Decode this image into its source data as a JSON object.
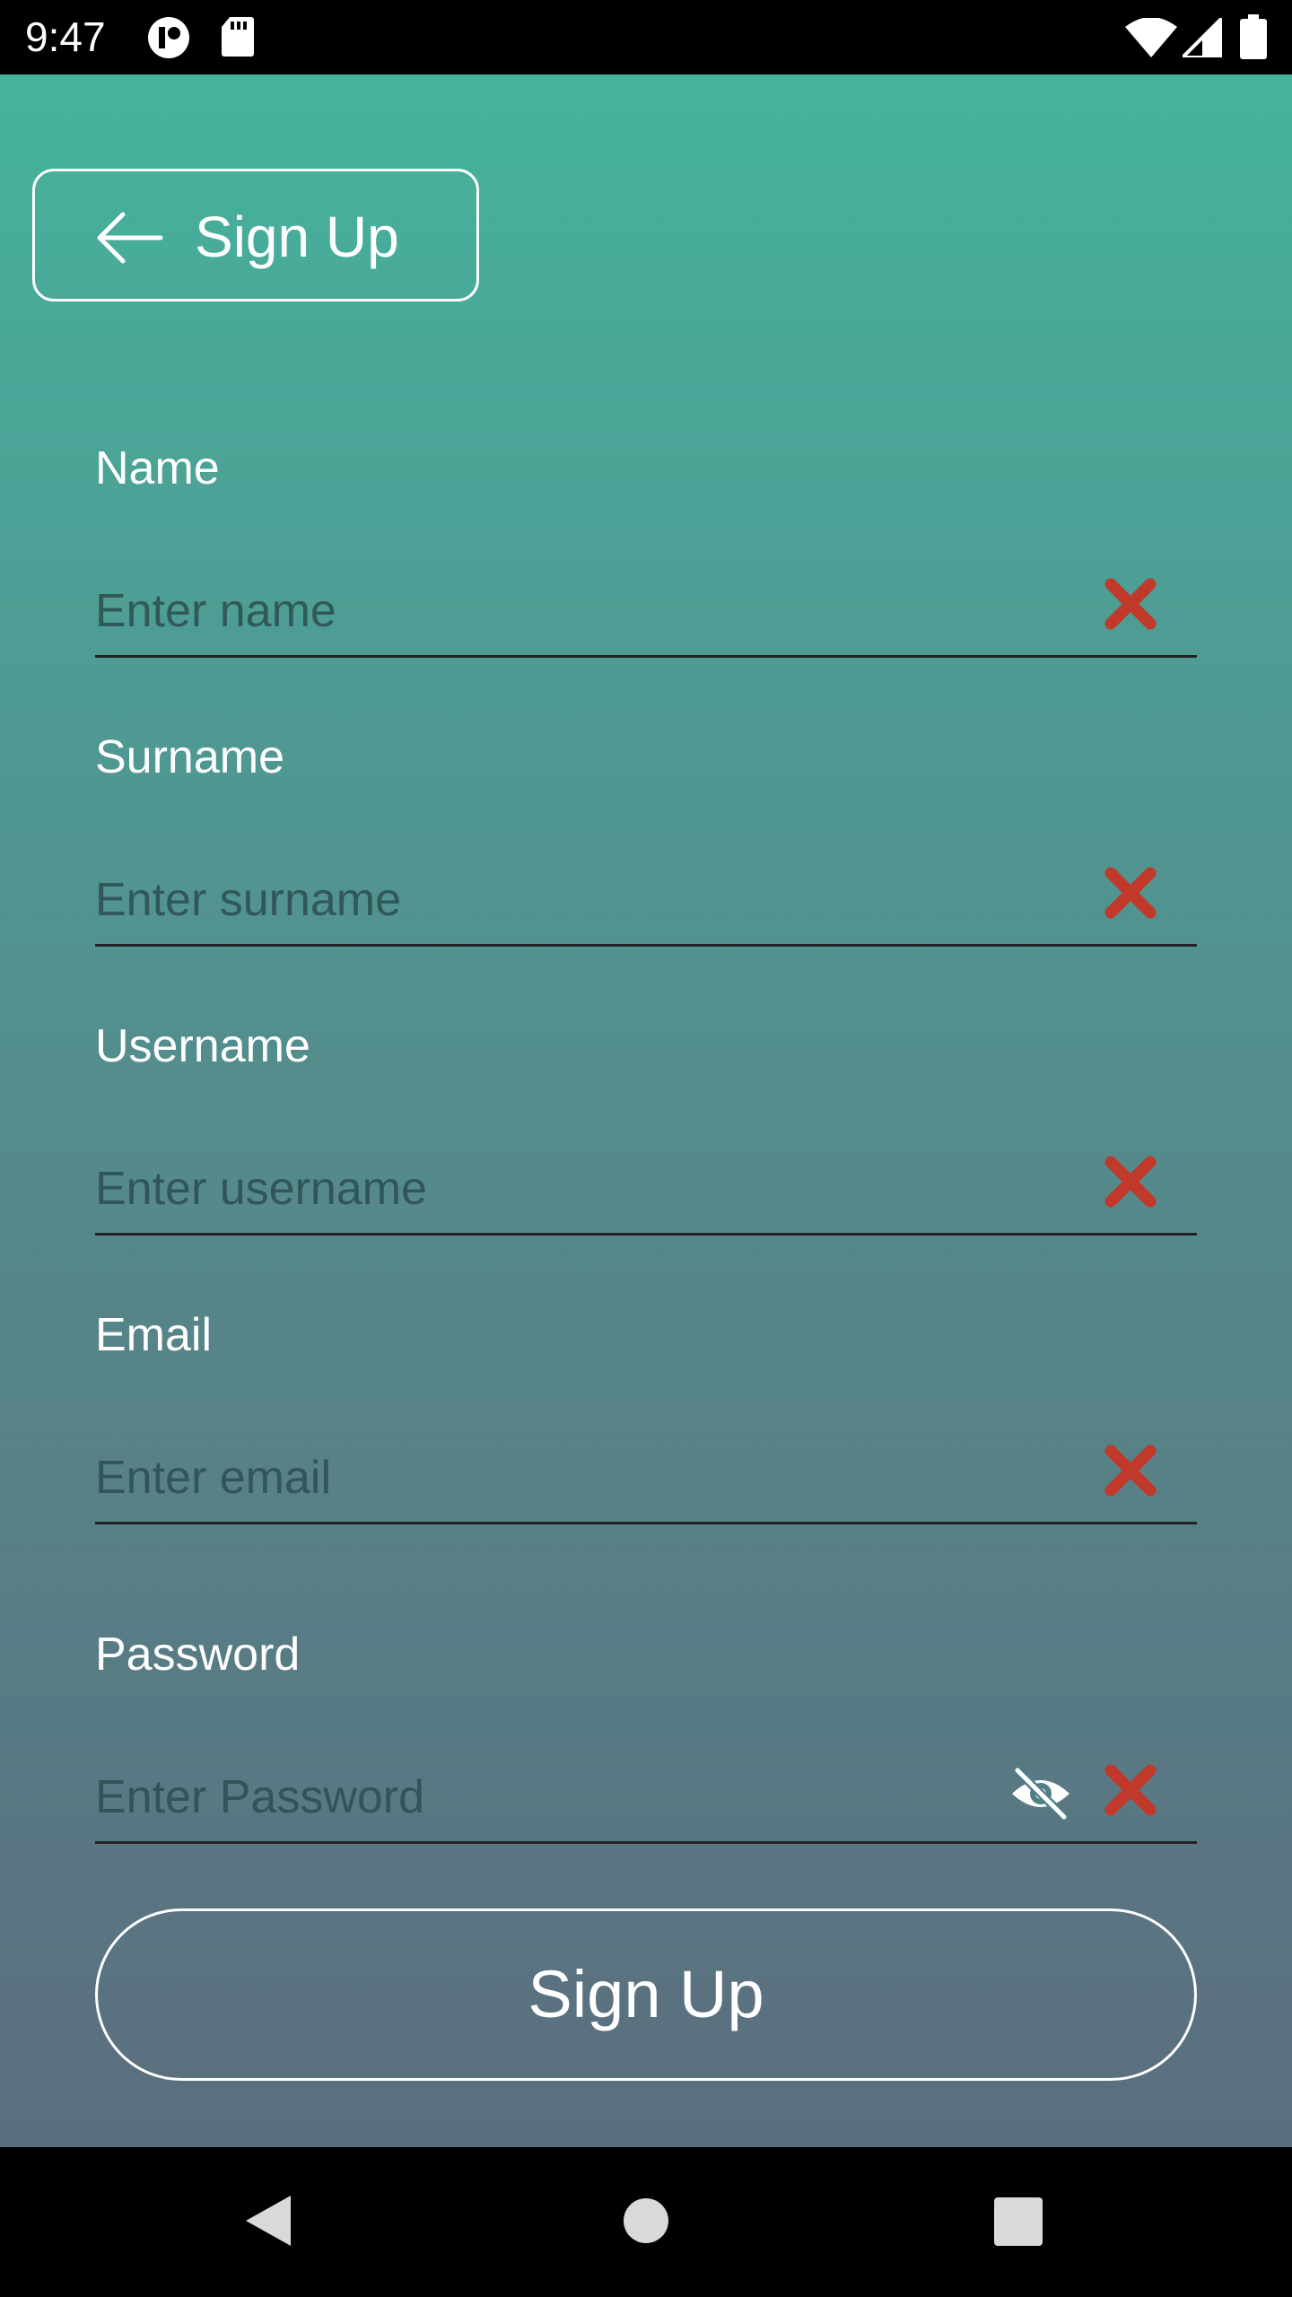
{
  "status_bar": {
    "time": "9:47",
    "icons": [
      "app-notification-icon",
      "sd-card-icon",
      "wifi-icon",
      "cell-signal-icon",
      "battery-icon"
    ]
  },
  "header": {
    "back_icon": "arrow-left-icon",
    "title": "Sign Up"
  },
  "form": {
    "fields": [
      {
        "label": "Name",
        "placeholder": "Enter name",
        "value": ""
      },
      {
        "label": "Surname",
        "placeholder": "Enter surname",
        "value": ""
      },
      {
        "label": "Username",
        "placeholder": "Enter username",
        "value": ""
      },
      {
        "label": "Email",
        "placeholder": "Enter email",
        "value": ""
      },
      {
        "label": "Password",
        "placeholder": "Enter Password",
        "value": ""
      }
    ],
    "clear_icon": "close-x-icon",
    "visibility_icon": "eye-off-icon",
    "submit_label": "Sign Up"
  },
  "nav_bar": {
    "buttons": [
      "back-triangle-icon",
      "home-circle-icon",
      "recents-square-icon"
    ]
  },
  "colors": {
    "gradient_top": "#45b39c",
    "gradient_bottom": "#5b6e7e",
    "clear_icon": "#c0392b",
    "text_light": "#ffffff"
  }
}
